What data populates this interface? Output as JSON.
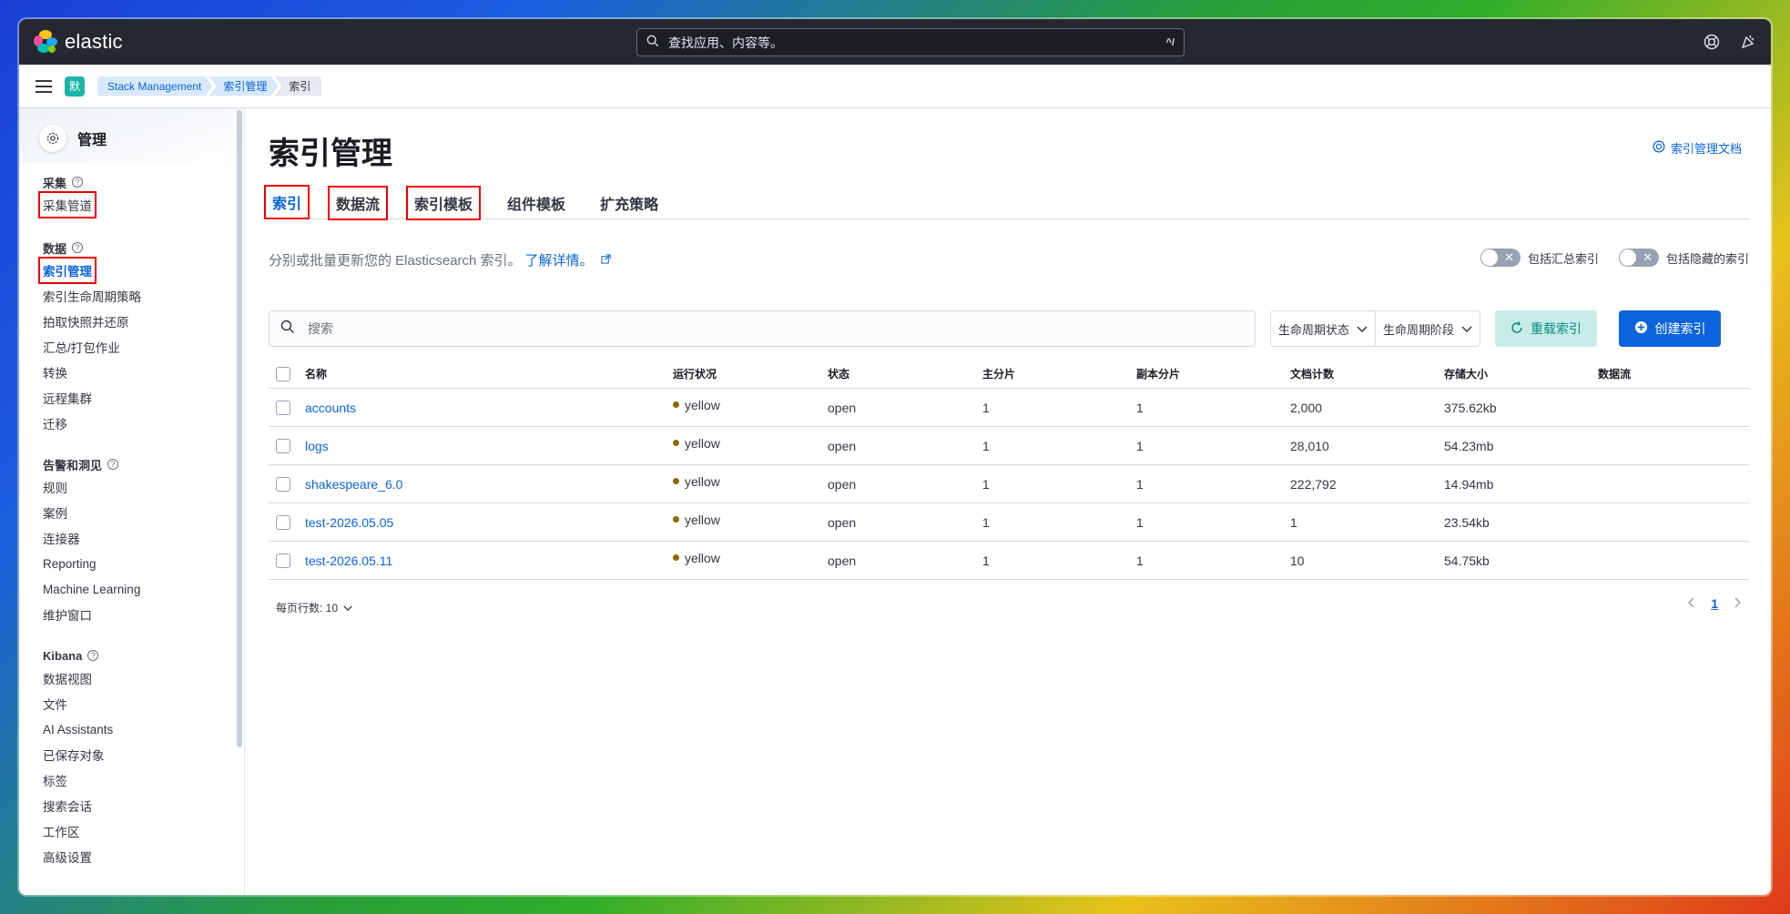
{
  "header": {
    "brand": "elastic",
    "search_placeholder": "查找应用、内容等。",
    "search_shortcut": "^/"
  },
  "breadcrumb": {
    "space_initial": "默",
    "items": [
      "Stack Management",
      "索引管理",
      "索引"
    ]
  },
  "sidebar": {
    "title": "管理",
    "groups": [
      {
        "title": "采集",
        "items": [
          "采集管道"
        ]
      },
      {
        "title": "数据",
        "items": [
          "索引管理",
          "索引生命周期策略",
          "拍取快照并还原",
          "汇总/打包作业",
          "转换",
          "远程集群",
          "迁移"
        ]
      },
      {
        "title": "告警和洞见",
        "items": [
          "规则",
          "案例",
          "连接器",
          "Reporting",
          "Machine Learning",
          "维护窗口"
        ]
      },
      {
        "title": "Kibana",
        "items": [
          "数据视图",
          "文件",
          "AI Assistants",
          "已保存对象",
          "标签",
          "搜索会话",
          "工作区",
          "高级设置"
        ]
      }
    ]
  },
  "main": {
    "title": "索引管理",
    "doc_link": "索引管理文档",
    "tabs": [
      "索引",
      "数据流",
      "索引模板",
      "组件模板",
      "扩充策略"
    ],
    "description": "分别或批量更新您的 Elasticsearch 索引。",
    "learn_more": "了解详情。",
    "toggles": [
      "包括汇总索引",
      "包括隐藏的索引"
    ],
    "search_placeholder": "搜索",
    "filters": [
      "生命周期状态",
      "生命周期阶段"
    ],
    "reload_label": "重载索引",
    "create_label": "创建索引",
    "table": {
      "columns": [
        "名称",
        "运行状况",
        "状态",
        "主分片",
        "副本分片",
        "文档计数",
        "存储大小",
        "数据流"
      ],
      "rows": [
        {
          "name": "accounts",
          "health": "yellow",
          "status": "open",
          "primary": "1",
          "replicas": "1",
          "docs": "2,000",
          "size": "375.62kb",
          "stream": ""
        },
        {
          "name": "logs",
          "health": "yellow",
          "status": "open",
          "primary": "1",
          "replicas": "1",
          "docs": "28,010",
          "size": "54.23mb",
          "stream": ""
        },
        {
          "name": "shakespeare_6.0",
          "health": "yellow",
          "status": "open",
          "primary": "1",
          "replicas": "1",
          "docs": "222,792",
          "size": "14.94mb",
          "stream": ""
        },
        {
          "name": "test-2026.05.05",
          "health": "yellow",
          "status": "open",
          "primary": "1",
          "replicas": "1",
          "docs": "1",
          "size": "23.54kb",
          "stream": ""
        },
        {
          "name": "test-2026.05.11",
          "health": "yellow",
          "status": "open",
          "primary": "1",
          "replicas": "1",
          "docs": "10",
          "size": "54.75kb",
          "stream": ""
        }
      ]
    },
    "rows_per_page": "每页行数: 10",
    "current_page": "1"
  },
  "colors": {
    "accent": "#0b64dd",
    "health_yellow": "#8d6b00",
    "header_bg": "#25282f",
    "highlight_box": "#e00000"
  }
}
